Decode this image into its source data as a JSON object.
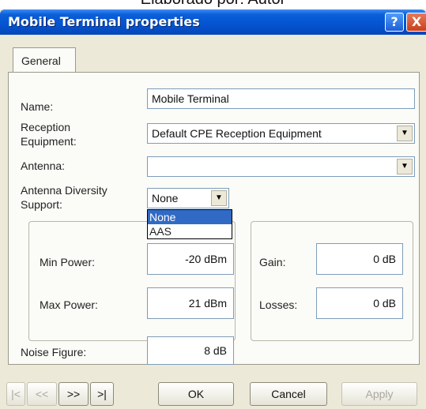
{
  "caption": "Elaborado por: Autor",
  "window": {
    "title": "Mobile Terminal properties",
    "help_glyph": "?",
    "close_glyph": "X"
  },
  "tabs": [
    "General"
  ],
  "form": {
    "name_label": "Name:",
    "name_value": "Mobile Terminal",
    "reception_label_line1": "Reception",
    "reception_label_line2": "Equipment:",
    "reception_value": "Default CPE Reception Equipment",
    "antenna_label": "Antenna:",
    "antenna_value": "",
    "diversity_label_line1": "Antenna Diversity",
    "diversity_label_line2": "Support:",
    "diversity_value": "None",
    "diversity_options": [
      "None",
      "AAS"
    ],
    "min_power_label": "Min Power:",
    "min_power_value": "-20 dBm",
    "max_power_label": "Max Power:",
    "max_power_value": "21 dBm",
    "gain_label": "Gain:",
    "gain_value": "0 dB",
    "losses_label": "Losses:",
    "losses_value": "0 dB",
    "noise_label": "Noise Figure:",
    "noise_value": "8 dB"
  },
  "footer": {
    "first_label": "|<",
    "prev_label": "<<",
    "next_label": ">>",
    "last_label": ">|",
    "ok_label": "OK",
    "cancel_label": "Cancel",
    "apply_label": "Apply"
  },
  "icons": {
    "dropdown_arrow": "▼"
  },
  "colors": {
    "titlebar": "#0553d0",
    "dialog_bg": "#ece9d8",
    "selection": "#316ac5"
  }
}
